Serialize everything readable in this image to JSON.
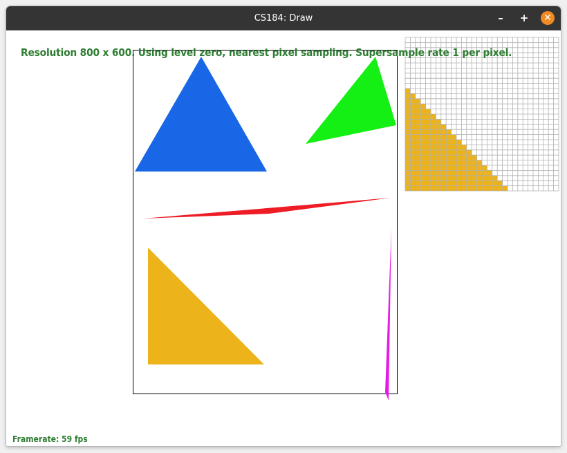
{
  "window": {
    "title": "CS184: Draw",
    "buttons": {
      "minimize": "–",
      "maximize": "+",
      "close": "✕"
    }
  },
  "status_line": "Resolution 800 x 600. Using level zero, nearest pixel sampling. Supersample rate 1 per pixel.",
  "framerate_label": "Framerate: 59 fps",
  "colors": {
    "status_text": "#2e7d32",
    "triangle_blue": "#1967e6",
    "triangle_green": "#14ef14",
    "sliver_red": "#ee1c25",
    "triangle_yellow": "#ecb31a",
    "sliver_magenta": "#e61ce6",
    "grid_line": "#b0b0b0",
    "close_button": "#f08a24"
  },
  "icons": {
    "minimize": "minimize-icon",
    "maximize": "maximize-icon",
    "close": "close-icon"
  }
}
